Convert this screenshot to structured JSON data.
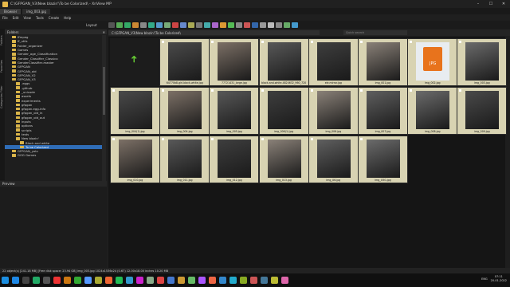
{
  "window": {
    "title": "C:\\GFPGAN_V3\\New blazin'\\To be Colorized\\ - XnView MP"
  },
  "tabs": [
    {
      "label": "Browser"
    },
    {
      "label": "img_003.jpg"
    }
  ],
  "menu": [
    "File",
    "Edit",
    "View",
    "Tools",
    "Create",
    "Help"
  ],
  "toolbar": {
    "layout_label": "Layout"
  },
  "side_tabs": [
    "Folders",
    "Favorites",
    "Categories Filter"
  ],
  "folders": {
    "header": "Folders",
    "items": [
      {
        "label": "ffmpeg",
        "depth": 3
      },
      {
        "label": "ff_utils",
        "depth": 3
      },
      {
        "label": "Folder_organizer",
        "depth": 3
      },
      {
        "label": "Games",
        "depth": 3
      },
      {
        "label": "Gender_age_Classification",
        "depth": 3
      },
      {
        "label": "Gender_Classifier_Classico",
        "depth": 3
      },
      {
        "label": "GenderClassifier-master",
        "depth": 3
      },
      {
        "label": "GFPGAN",
        "depth": 3
      },
      {
        "label": "GFPGAN_old",
        "depth": 3
      },
      {
        "label": "GFPGAN_V2",
        "depth": 3
      },
      {
        "label": "GFPGAN_V3",
        "depth": 3
      },
      {
        "label": ".eggs",
        "depth": 4
      },
      {
        "label": ".github",
        "depth": 4
      },
      {
        "label": "_unicode",
        "depth": 4
      },
      {
        "label": "assets",
        "depth": 4
      },
      {
        "label": "experiments",
        "depth": 4
      },
      {
        "label": "gfpgan",
        "depth": 4
      },
      {
        "label": "gfpgan.egg-info",
        "depth": 4
      },
      {
        "label": "gfpgan_old_in",
        "depth": 4
      },
      {
        "label": "gfpgan_old_out",
        "depth": 4
      },
      {
        "label": "inputs",
        "depth": 4
      },
      {
        "label": "options",
        "depth": 4
      },
      {
        "label": "scripts",
        "depth": 4
      },
      {
        "label": "tests",
        "depth": 4
      },
      {
        "label": "New blazin'",
        "depth": 4
      },
      {
        "label": "Black and white",
        "depth": 5
      },
      {
        "label": "To be Colorized",
        "depth": 5,
        "selected": true
      },
      {
        "label": "GFPGAN_yolo",
        "depth": 3
      },
      {
        "label": "GOG Games",
        "depth": 3
      }
    ]
  },
  "preview": {
    "header": "Preview"
  },
  "address": {
    "path": "C:\\GFPGAN_V3\\New blazin'\\To be Colorized\\",
    "search_placeholder": "Quick search"
  },
  "thumbnails": [
    {
      "caption": "",
      "meta": "",
      "type": "up"
    },
    {
      "caption": "64770b8-girl-black-white.jpg",
      "meta": "",
      "hl": true
    },
    {
      "caption": "77721431_large.jpg",
      "meta": "",
      "hl": true
    },
    {
      "caption": "black-and-white-4824632_960_720",
      "meta": "",
      "hl": true
    },
    {
      "caption": "ele.mirror.jpg",
      "meta": "",
      "hl": true
    },
    {
      "caption": "img_001.jpg",
      "meta": "",
      "hl": true
    },
    {
      "caption": "img_002.jpg",
      "meta": "",
      "hl": true,
      "type": "jpg"
    },
    {
      "caption": "img_003.jpg",
      "meta": "",
      "hl": true
    },
    {
      "caption": "img_004(1).jpg",
      "meta": "",
      "hl": true
    },
    {
      "caption": "img_004.jpg",
      "meta": "",
      "hl": true
    },
    {
      "caption": "img_005.jpg",
      "meta": "",
      "hl": true
    },
    {
      "caption": "img_006(1).jpg",
      "meta": "",
      "hl": true
    },
    {
      "caption": "img_006.jpg",
      "meta": "",
      "hl": true
    },
    {
      "caption": "img_007.jpg",
      "meta": "",
      "hl": true
    },
    {
      "caption": "img_008.jpg",
      "meta": "",
      "hl": true
    },
    {
      "caption": "img_009.jpg",
      "meta": "",
      "hl": true
    },
    {
      "caption": "img_010.jpg",
      "meta": "",
      "hl": true
    },
    {
      "caption": "img_011.jpg",
      "meta": "",
      "hl": true
    },
    {
      "caption": "img_012.jpg",
      "meta": "",
      "hl": true
    },
    {
      "caption": "img_013.jpg",
      "meta": "",
      "hl": true
    },
    {
      "caption": "img_U6.jpg",
      "meta": "",
      "hl": true
    },
    {
      "caption": "img_U5G.jpg",
      "meta": "",
      "hl": true
    }
  ],
  "jpg_label": "JPG",
  "status": "22 object(s) [241.18 MB] [Free disk space: 23.94 GB]  img_003.jpg  1024x1536x24 (0.67)  12.00x18.00 inches  10.20 MB",
  "tray": {
    "lang": "ENG",
    "time": "07:11",
    "date": "20-01-2022"
  }
}
